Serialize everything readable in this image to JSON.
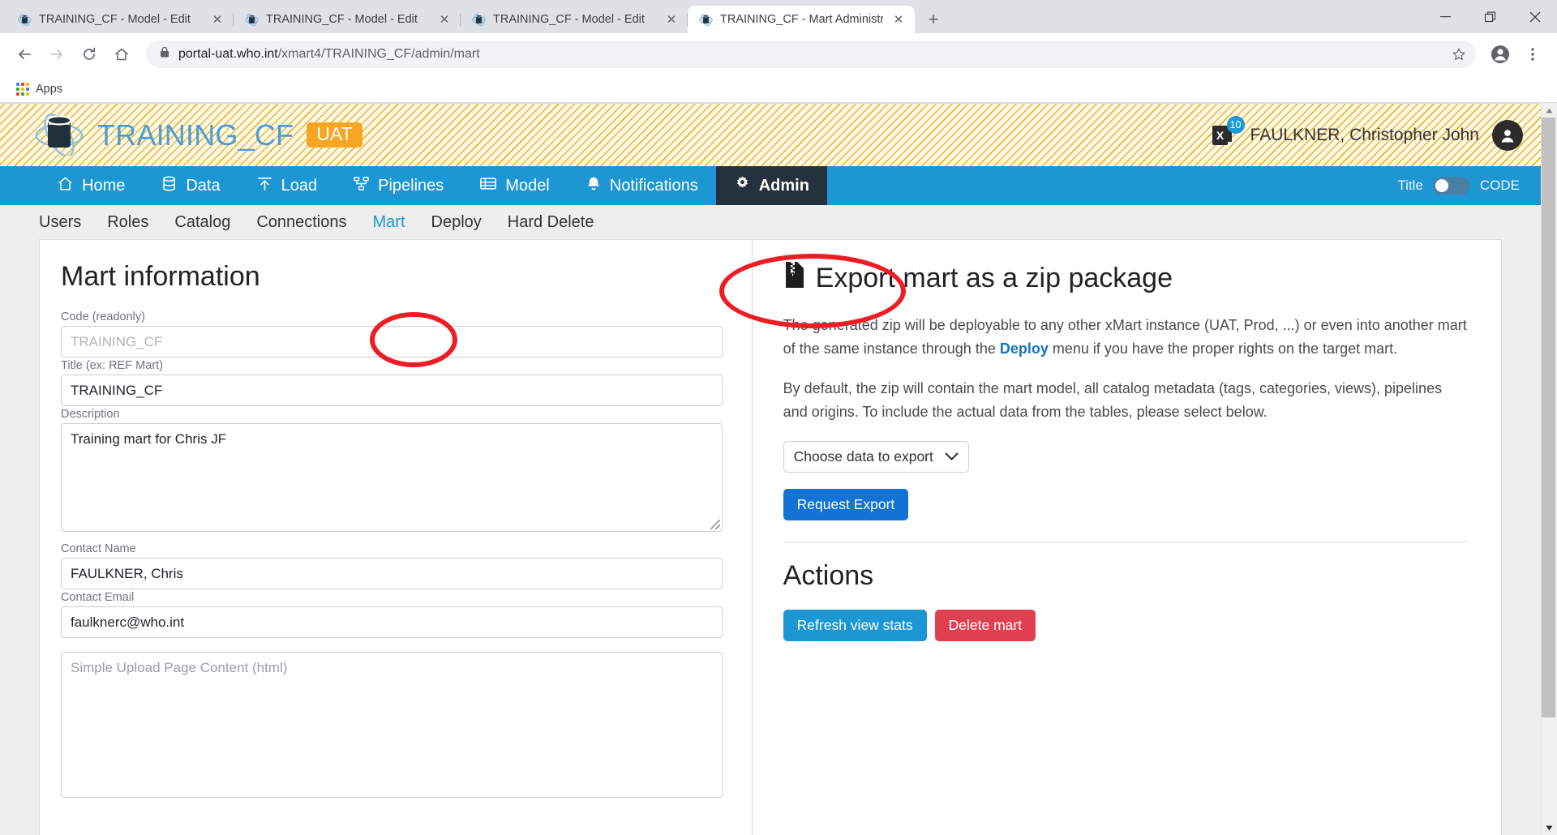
{
  "browser": {
    "tabs": [
      {
        "title": "TRAINING_CF - Model - Edit",
        "close": "✕",
        "active": false
      },
      {
        "title": "TRAINING_CF - Model - Edit",
        "close": "✕",
        "active": false
      },
      {
        "title": "TRAINING_CF - Model - Edit",
        "close": "✕",
        "active": false
      },
      {
        "title": "TRAINING_CF - Mart Administrati",
        "close": "✕",
        "active": true
      }
    ],
    "new_tab_label": "+",
    "window_controls": {
      "minimize": "—",
      "restore": "❐",
      "close": "✕"
    },
    "nav": {
      "back": "←",
      "forward": "→",
      "reload": "⟳",
      "home": "⌂"
    },
    "url_secure": "portal-uat.who.int",
    "url_path": "/xmart4/TRAINING_CF/admin/mart",
    "url_full": "portal-uat.who.int/xmart4/TRAINING_CF/admin/mart",
    "bookmarks": [
      {
        "label": "Apps",
        "icon": "apps-grid-icon"
      }
    ]
  },
  "header": {
    "logo_alt": "xmart-logo",
    "mart_title": "TRAINING_CF",
    "environment_badge": "UAT",
    "export_icon": "excel-export-icon",
    "notification_count": "10",
    "user_name": "FAULKNER, Christopher John",
    "avatar_alt": "user-avatar"
  },
  "mainnav": {
    "items": [
      {
        "label": "Home",
        "icon": "home-icon",
        "active": false
      },
      {
        "label": "Data",
        "icon": "database-icon",
        "active": false
      },
      {
        "label": "Load",
        "icon": "upload-icon",
        "active": false
      },
      {
        "label": "Pipelines",
        "icon": "pipeline-icon",
        "active": false
      },
      {
        "label": "Model",
        "icon": "table-icon",
        "active": false
      },
      {
        "label": "Notifications",
        "icon": "bell-icon",
        "active": false
      },
      {
        "label": "Admin",
        "icon": "gear-icon",
        "active": true
      }
    ],
    "toggle_left_label": "Title",
    "toggle_right_label": "CODE"
  },
  "subnav": {
    "items": [
      {
        "label": "Users",
        "active": false
      },
      {
        "label": "Roles",
        "active": false
      },
      {
        "label": "Catalog",
        "active": false
      },
      {
        "label": "Connections",
        "active": false
      },
      {
        "label": "Mart",
        "active": true
      },
      {
        "label": "Deploy",
        "active": false
      },
      {
        "label": "Hard Delete",
        "active": false
      }
    ]
  },
  "mart_info": {
    "title": "Mart information",
    "code": {
      "label": "Code (readonly)",
      "value": "TRAINING_CF"
    },
    "mart_title": {
      "label": "Title (ex: REF Mart)",
      "value": "TRAINING_CF"
    },
    "description": {
      "label": "Description",
      "value": "Training mart for Chris JF"
    },
    "contact_name": {
      "label": "Contact Name",
      "value": "FAULKNER, Chris"
    },
    "contact_email": {
      "label": "Contact Email",
      "value": "faulknerc@who.int"
    },
    "upload_page": {
      "placeholder": "Simple Upload Page Content (html)",
      "value": ""
    }
  },
  "export": {
    "title": "Export mart as a zip package",
    "icon": "zip-file-icon",
    "para1_before": "The generated zip will be deployable to any other xMart instance (UAT, Prod, ...) or even into another mart of the same instance through the ",
    "para1_link": "Deploy",
    "para1_after": " menu if you have the proper rights on the target mart.",
    "para2": "By default, the zip will contain the mart model, all catalog metadata (tags, categories, views), pipelines and origins. To include the actual data from the tables, please select below.",
    "select_label": "Choose data to export",
    "request_button": "Request Export"
  },
  "actions": {
    "title": "Actions",
    "refresh_button": "Refresh view stats",
    "delete_button": "Delete mart"
  },
  "annotations": [
    {
      "name": "admin-menu-highlight",
      "shape": "ellipse"
    },
    {
      "name": "mart-tab-highlight",
      "shape": "ellipse"
    }
  ],
  "colors": {
    "brand_blue": "#1c97d4",
    "accent_yellow": "#f6a623",
    "nav_active_dark": "#25313c",
    "danger_red": "#e04151",
    "primary_blue": "#1273d4",
    "annotation_red": "#ee1c24"
  }
}
